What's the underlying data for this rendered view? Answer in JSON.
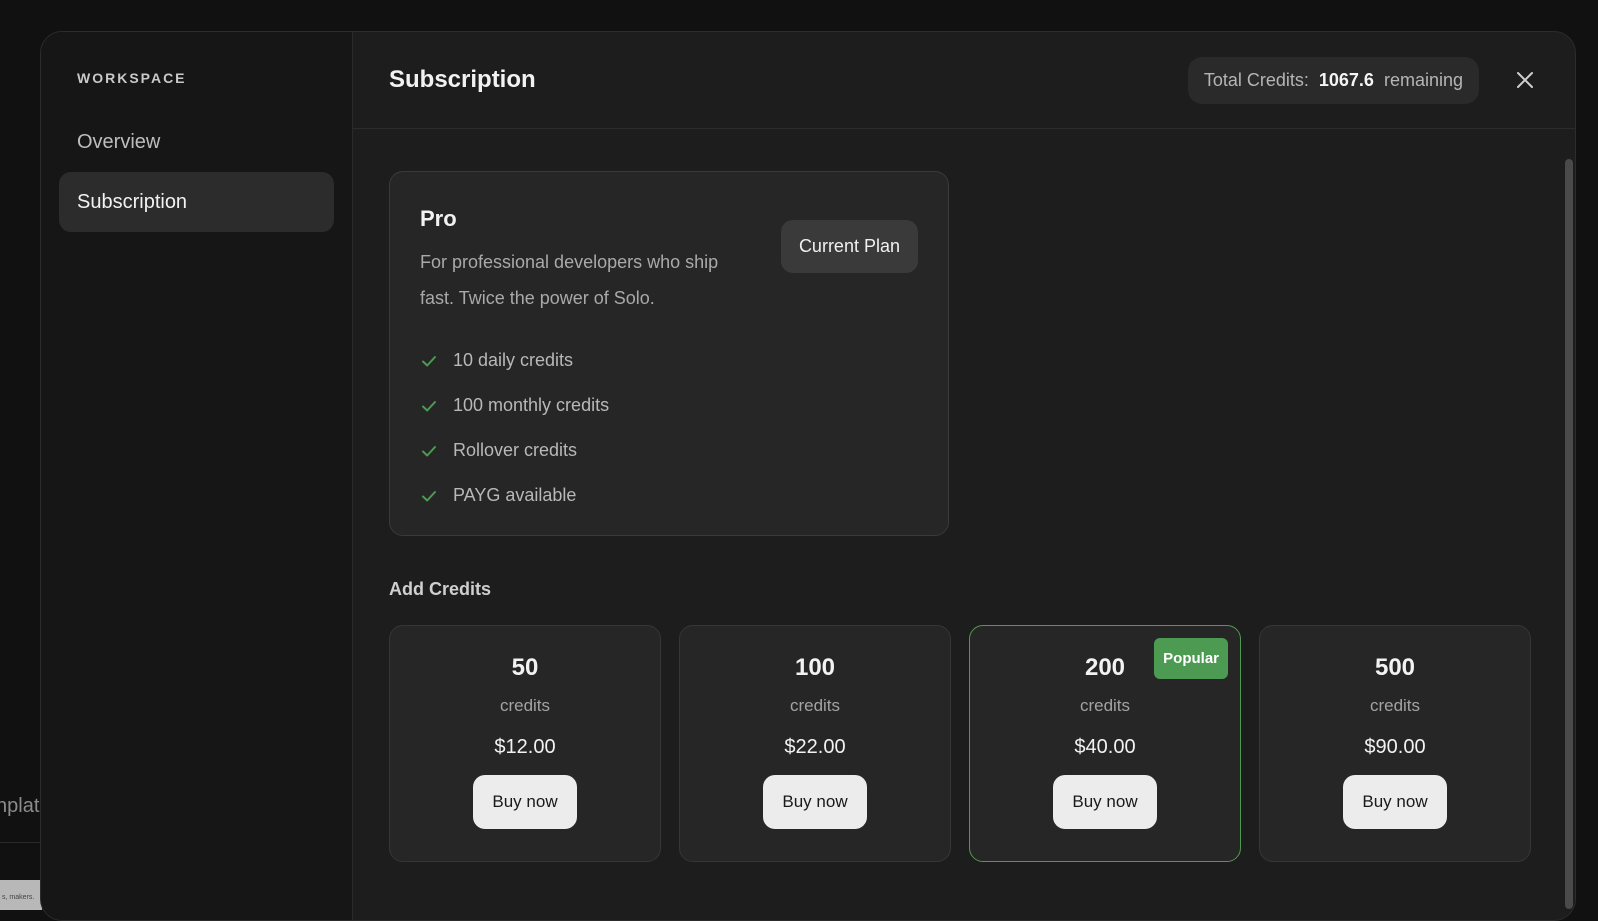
{
  "background": {
    "partial_text": "nplate",
    "thumb_text": "s, makers."
  },
  "sidebar": {
    "heading": "WORKSPACE",
    "items": [
      {
        "label": "Overview",
        "active": false
      },
      {
        "label": "Subscription",
        "active": true
      }
    ]
  },
  "header": {
    "title": "Subscription",
    "credits_label": "Total Credits:",
    "credits_value": "1067.6",
    "credits_suffix": "remaining"
  },
  "plan": {
    "name": "Pro",
    "description": "For professional developers who ship fast. Twice the power of Solo.",
    "button_label": "Current Plan",
    "features": [
      "10 daily credits",
      "100 monthly credits",
      "Rollover credits",
      "PAYG available"
    ]
  },
  "add_credits": {
    "title": "Add Credits",
    "unit_label": "credits",
    "buy_label": "Buy now",
    "badge_label": "Popular",
    "packs": [
      {
        "amount": "50",
        "price": "$12.00",
        "popular": false
      },
      {
        "amount": "100",
        "price": "$22.00",
        "popular": false
      },
      {
        "amount": "200",
        "price": "$40.00",
        "popular": true
      },
      {
        "amount": "500",
        "price": "$90.00",
        "popular": false
      }
    ]
  },
  "colors": {
    "accent_green": "#4d9a53",
    "background": "#111111",
    "panel": "#1d1d1d"
  }
}
